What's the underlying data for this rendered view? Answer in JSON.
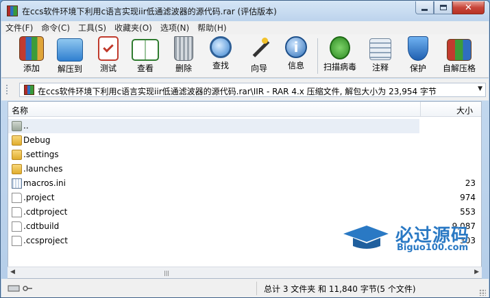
{
  "window": {
    "title": "在ccs软件环境下利用c语言实现iir低通滤波器的源代码.rar (评估版本)",
    "close_label": "✕"
  },
  "menu": [
    "文件(F)",
    "命令(C)",
    "工具(S)",
    "收藏夹(O)",
    "选项(N)",
    "帮助(H)"
  ],
  "toolbar": [
    {
      "label": "添加",
      "icon": "books-add-icon"
    },
    {
      "label": "解压到",
      "icon": "folder-extract-icon"
    },
    {
      "label": "测试",
      "icon": "clipboard-check-icon"
    },
    {
      "label": "查看",
      "icon": "open-book-icon"
    },
    {
      "label": "删除",
      "icon": "trash-bin-icon"
    },
    {
      "label": "查找",
      "icon": "magnifier-icon"
    },
    {
      "label": "向导",
      "icon": "magic-wand-icon"
    },
    {
      "label": "信息",
      "icon": "info-icon"
    },
    {
      "label": "扫描病毒",
      "icon": "bug-scan-icon"
    },
    {
      "label": "注释",
      "icon": "comment-icon"
    },
    {
      "label": "保护",
      "icon": "shield-icon"
    },
    {
      "label": "自解压格",
      "icon": "sfx-box-icon"
    }
  ],
  "address": {
    "path": "在ccs软件环境下利用c语言实现iir低通滤波器的源代码.rar\\IIR - RAR 4.x 压缩文件, 解包大小为 23,954 字节"
  },
  "columns": {
    "name": "名称",
    "size": "大小"
  },
  "files": [
    {
      "name": "..",
      "size": "",
      "type": "parent-folder"
    },
    {
      "name": "Debug",
      "size": "",
      "type": "folder"
    },
    {
      "name": ".settings",
      "size": "",
      "type": "folder"
    },
    {
      "name": ".launches",
      "size": "",
      "type": "folder"
    },
    {
      "name": "macros.ini",
      "size": "23",
      "type": "settings-file"
    },
    {
      "name": ".project",
      "size": "974",
      "type": "file"
    },
    {
      "name": ".cdtproject",
      "size": "553",
      "type": "file"
    },
    {
      "name": ".cdtbuild",
      "size": "9,087",
      "type": "file"
    },
    {
      "name": ".ccsproject",
      "size": "303",
      "type": "file"
    }
  ],
  "watermark": {
    "title": "必过源码",
    "subtitle": "Biguo100.com"
  },
  "status": {
    "summary": "总计 3 文件夹 和 11,840 字节(5 个文件)"
  },
  "colors": {
    "accent": "#2a79c4",
    "title_bar": "#c9ddf2",
    "close_button": "#c8463a"
  }
}
